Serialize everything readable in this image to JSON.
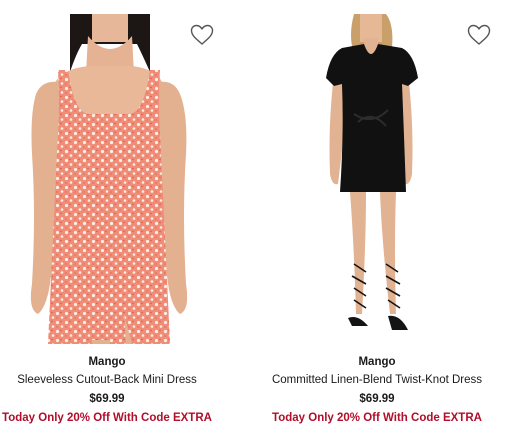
{
  "colors": {
    "promo": "#b00e2a",
    "text": "#1a1a1a"
  },
  "products": [
    {
      "brand": "Mango",
      "name": "Sleeveless Cutout-Back Mini Dress",
      "price": "$69.99",
      "promo": "Today Only 20% Off With Code EXTRA",
      "favorite_icon": "heart-outline-icon"
    },
    {
      "brand": "Mango",
      "name": "Committed Linen-Blend Twist-Knot Dress",
      "price": "$69.99",
      "promo": "Today Only 20% Off With Code EXTRA",
      "favorite_icon": "heart-outline-icon"
    }
  ]
}
